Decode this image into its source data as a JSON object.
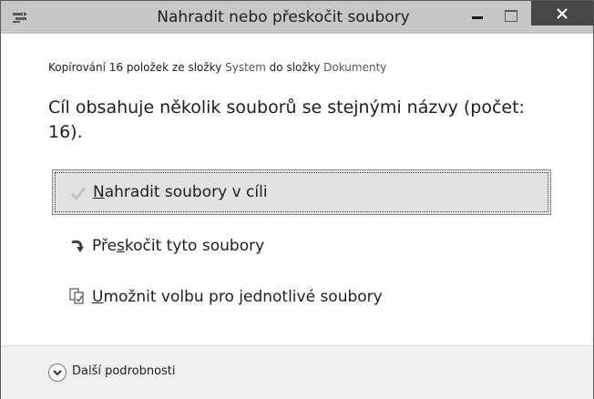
{
  "window": {
    "title": "Nahradit nebo přeskočit soubory",
    "controls": {
      "minimize": "minimize-icon",
      "maximize": "maximize-icon",
      "close": "close-icon"
    }
  },
  "summary": {
    "prefix": "Kopírování 16 položek ze složky ",
    "source": "System",
    "middle": " do složky ",
    "destination": "Dokumenty"
  },
  "heading": "Cíl obsahuje několik souborů se stejnými názvy (počet: 16).",
  "options": {
    "replace": {
      "pre": "",
      "accel": "N",
      "post": "ahradit soubory v cíli",
      "icon": "checkmark-icon"
    },
    "skip": {
      "pre": "Pře",
      "accel": "s",
      "post": "kočit tyto soubory",
      "icon": "skip-arrow-icon"
    },
    "decide": {
      "pre": "",
      "accel": "U",
      "post": "možnit volbu pro jednotlivé soubory",
      "icon": "compare-files-icon"
    }
  },
  "footer": {
    "more_details": "Další podrobnosti",
    "icon": "chevron-down-icon"
  },
  "colors": {
    "titlebar": "#c7c7c7",
    "close_button": "#474747",
    "selected_option": "#e2e2e2",
    "footer": "#f0f0f0"
  }
}
